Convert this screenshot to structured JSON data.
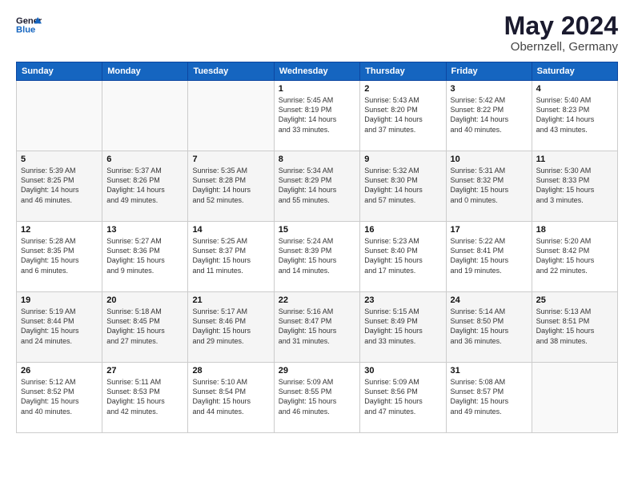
{
  "header": {
    "logo_line1": "General",
    "logo_line2": "Blue",
    "month": "May 2024",
    "location": "Obernzell, Germany"
  },
  "weekdays": [
    "Sunday",
    "Monday",
    "Tuesday",
    "Wednesday",
    "Thursday",
    "Friday",
    "Saturday"
  ],
  "weeks": [
    [
      {
        "day": "",
        "info": ""
      },
      {
        "day": "",
        "info": ""
      },
      {
        "day": "",
        "info": ""
      },
      {
        "day": "1",
        "info": "Sunrise: 5:45 AM\nSunset: 8:19 PM\nDaylight: 14 hours\nand 33 minutes."
      },
      {
        "day": "2",
        "info": "Sunrise: 5:43 AM\nSunset: 8:20 PM\nDaylight: 14 hours\nand 37 minutes."
      },
      {
        "day": "3",
        "info": "Sunrise: 5:42 AM\nSunset: 8:22 PM\nDaylight: 14 hours\nand 40 minutes."
      },
      {
        "day": "4",
        "info": "Sunrise: 5:40 AM\nSunset: 8:23 PM\nDaylight: 14 hours\nand 43 minutes."
      }
    ],
    [
      {
        "day": "5",
        "info": "Sunrise: 5:39 AM\nSunset: 8:25 PM\nDaylight: 14 hours\nand 46 minutes."
      },
      {
        "day": "6",
        "info": "Sunrise: 5:37 AM\nSunset: 8:26 PM\nDaylight: 14 hours\nand 49 minutes."
      },
      {
        "day": "7",
        "info": "Sunrise: 5:35 AM\nSunset: 8:28 PM\nDaylight: 14 hours\nand 52 minutes."
      },
      {
        "day": "8",
        "info": "Sunrise: 5:34 AM\nSunset: 8:29 PM\nDaylight: 14 hours\nand 55 minutes."
      },
      {
        "day": "9",
        "info": "Sunrise: 5:32 AM\nSunset: 8:30 PM\nDaylight: 14 hours\nand 57 minutes."
      },
      {
        "day": "10",
        "info": "Sunrise: 5:31 AM\nSunset: 8:32 PM\nDaylight: 15 hours\nand 0 minutes."
      },
      {
        "day": "11",
        "info": "Sunrise: 5:30 AM\nSunset: 8:33 PM\nDaylight: 15 hours\nand 3 minutes."
      }
    ],
    [
      {
        "day": "12",
        "info": "Sunrise: 5:28 AM\nSunset: 8:35 PM\nDaylight: 15 hours\nand 6 minutes."
      },
      {
        "day": "13",
        "info": "Sunrise: 5:27 AM\nSunset: 8:36 PM\nDaylight: 15 hours\nand 9 minutes."
      },
      {
        "day": "14",
        "info": "Sunrise: 5:25 AM\nSunset: 8:37 PM\nDaylight: 15 hours\nand 11 minutes."
      },
      {
        "day": "15",
        "info": "Sunrise: 5:24 AM\nSunset: 8:39 PM\nDaylight: 15 hours\nand 14 minutes."
      },
      {
        "day": "16",
        "info": "Sunrise: 5:23 AM\nSunset: 8:40 PM\nDaylight: 15 hours\nand 17 minutes."
      },
      {
        "day": "17",
        "info": "Sunrise: 5:22 AM\nSunset: 8:41 PM\nDaylight: 15 hours\nand 19 minutes."
      },
      {
        "day": "18",
        "info": "Sunrise: 5:20 AM\nSunset: 8:42 PM\nDaylight: 15 hours\nand 22 minutes."
      }
    ],
    [
      {
        "day": "19",
        "info": "Sunrise: 5:19 AM\nSunset: 8:44 PM\nDaylight: 15 hours\nand 24 minutes."
      },
      {
        "day": "20",
        "info": "Sunrise: 5:18 AM\nSunset: 8:45 PM\nDaylight: 15 hours\nand 27 minutes."
      },
      {
        "day": "21",
        "info": "Sunrise: 5:17 AM\nSunset: 8:46 PM\nDaylight: 15 hours\nand 29 minutes."
      },
      {
        "day": "22",
        "info": "Sunrise: 5:16 AM\nSunset: 8:47 PM\nDaylight: 15 hours\nand 31 minutes."
      },
      {
        "day": "23",
        "info": "Sunrise: 5:15 AM\nSunset: 8:49 PM\nDaylight: 15 hours\nand 33 minutes."
      },
      {
        "day": "24",
        "info": "Sunrise: 5:14 AM\nSunset: 8:50 PM\nDaylight: 15 hours\nand 36 minutes."
      },
      {
        "day": "25",
        "info": "Sunrise: 5:13 AM\nSunset: 8:51 PM\nDaylight: 15 hours\nand 38 minutes."
      }
    ],
    [
      {
        "day": "26",
        "info": "Sunrise: 5:12 AM\nSunset: 8:52 PM\nDaylight: 15 hours\nand 40 minutes."
      },
      {
        "day": "27",
        "info": "Sunrise: 5:11 AM\nSunset: 8:53 PM\nDaylight: 15 hours\nand 42 minutes."
      },
      {
        "day": "28",
        "info": "Sunrise: 5:10 AM\nSunset: 8:54 PM\nDaylight: 15 hours\nand 44 minutes."
      },
      {
        "day": "29",
        "info": "Sunrise: 5:09 AM\nSunset: 8:55 PM\nDaylight: 15 hours\nand 46 minutes."
      },
      {
        "day": "30",
        "info": "Sunrise: 5:09 AM\nSunset: 8:56 PM\nDaylight: 15 hours\nand 47 minutes."
      },
      {
        "day": "31",
        "info": "Sunrise: 5:08 AM\nSunset: 8:57 PM\nDaylight: 15 hours\nand 49 minutes."
      },
      {
        "day": "",
        "info": ""
      }
    ]
  ]
}
